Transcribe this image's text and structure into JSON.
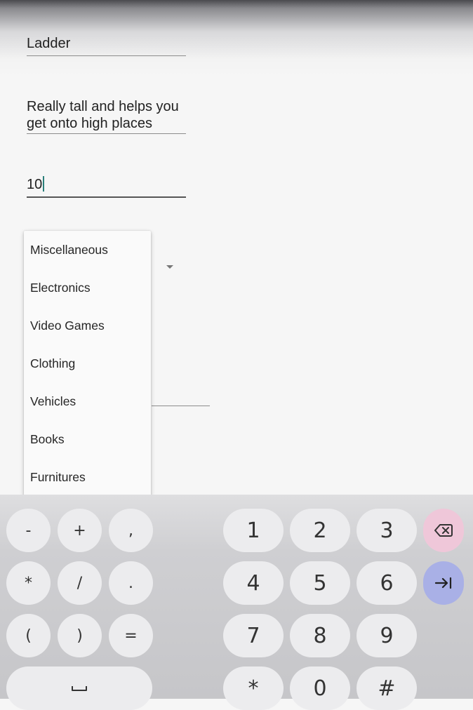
{
  "form": {
    "name_value": "Ladder",
    "description_value": "Really tall and helps you\nget onto high places",
    "price_value": "10"
  },
  "category_dropdown": {
    "items": [
      "Miscellaneous",
      "Electronics",
      "Video Games",
      "Clothing",
      "Vehicles",
      "Books",
      "Furnitures"
    ]
  },
  "keyboard": {
    "row1": [
      "-",
      "+",
      ",",
      "1",
      "2",
      "3"
    ],
    "row2": [
      "*",
      "/",
      ".",
      "4",
      "5",
      "6"
    ],
    "row3": [
      "(",
      ")",
      "=",
      "7",
      "8",
      "9"
    ],
    "row4": [
      "*",
      "0",
      "#"
    ],
    "backspace_icon": "backspace-icon",
    "tab_icon": "tab-right-icon",
    "space_icon": "space-bar-icon",
    "colors": {
      "key": "#ececee",
      "backspace": "#efc7d9",
      "enter": "#a9b0e6",
      "caret": "#2a7f7a"
    }
  }
}
